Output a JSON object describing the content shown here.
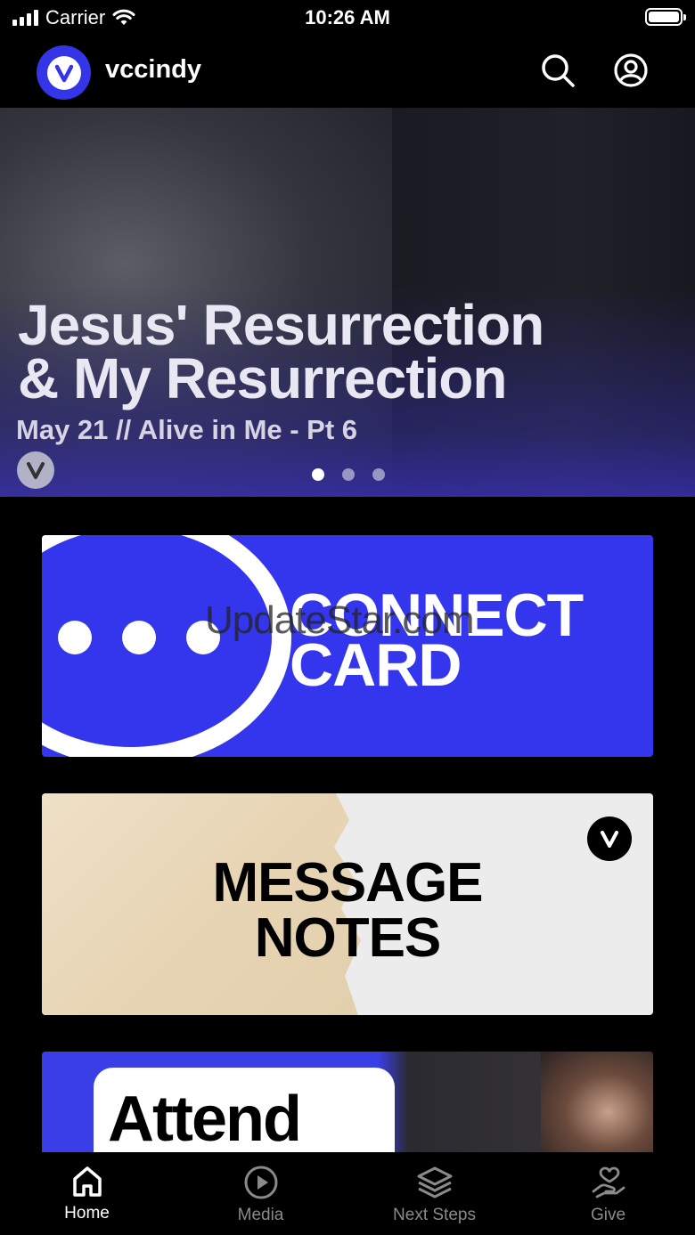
{
  "status_bar": {
    "carrier": "Carrier",
    "time": "10:26 AM"
  },
  "header": {
    "title": "vccindy",
    "logo_letter": "V",
    "icons": [
      "search-icon",
      "account-icon"
    ]
  },
  "hero": {
    "title_line1": "Jesus' Resurrection",
    "title_line2": "& My Resurrection",
    "subtitle": "May 21 // Alive in Me - Pt 6",
    "slide_count": 3,
    "active_slide": 1
  },
  "cards": {
    "connect": {
      "line1": "CONNECT",
      "line2": "CARD"
    },
    "notes": {
      "line1": "MESSAGE",
      "line2": "NOTES"
    },
    "attend": {
      "text": "Attend"
    }
  },
  "watermark": "UpdateStar.com",
  "tabs": [
    {
      "label": "Home",
      "icon": "home-icon",
      "active": true
    },
    {
      "label": "Media",
      "icon": "play-icon",
      "active": false
    },
    {
      "label": "Next Steps",
      "icon": "layers-icon",
      "active": false
    },
    {
      "label": "Give",
      "icon": "give-hand-heart-icon",
      "active": false
    }
  ],
  "colors": {
    "brand_blue": "#3336ec",
    "background": "#000000",
    "inactive_tab": "#8a8a8a"
  }
}
